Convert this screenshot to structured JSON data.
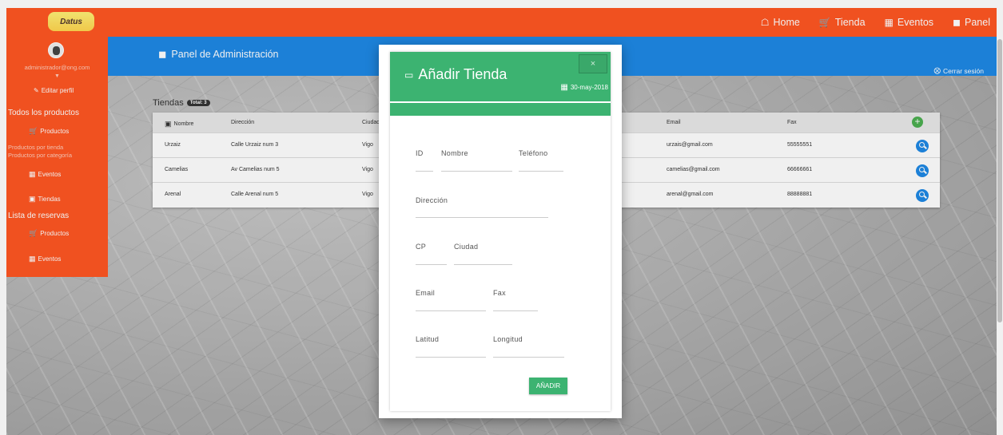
{
  "colors": {
    "orange": "#ff5722",
    "blue": "#1e88e5",
    "green": "#3cb371"
  },
  "navbar": {
    "logo": "Datus",
    "links": [
      {
        "label": "Home",
        "icon": "home-icon"
      },
      {
        "label": "Tienda",
        "icon": "cart-icon"
      },
      {
        "label": "Eventos",
        "icon": "calendar-icon"
      },
      {
        "label": "Panel",
        "icon": "briefcase-icon"
      }
    ]
  },
  "header": {
    "title": "Panel de Administración",
    "logout": "Cerrar sesión"
  },
  "sidebar": {
    "email": "administrador@ong.com",
    "edit_profile": "Editar perfil",
    "all_products": "Todos los productos",
    "products": "Productos",
    "by_store": "Productos por tienda",
    "by_category": "Productos por categoría",
    "events": "Eventos",
    "stores": "Tiendas",
    "reservations": "Lista de reservas",
    "res_products": "Productos",
    "res_events": "Eventos"
  },
  "stores": {
    "title": "Tiendas",
    "badge": "Total: 3",
    "headers": {
      "name": "Nombre",
      "address": "Dirección",
      "city": "Ciudad",
      "email": "Email",
      "fax": "Fax"
    },
    "rows": [
      {
        "name": "Urzaiz",
        "address": "Calle Urzaiz num 3",
        "city": "Vigo",
        "email": "urzais@gmail.com",
        "fax": "55555551"
      },
      {
        "name": "Camelias",
        "address": "Av Camelias num 5",
        "city": "Vigo",
        "email": "camelias@gmail.com",
        "fax": "66666661"
      },
      {
        "name": "Arenal",
        "address": "Calle Arenal num 5",
        "city": "Vigo",
        "email": "arenal@gmail.com",
        "fax": "88888881"
      }
    ]
  },
  "modal": {
    "title": "Añadir Tienda",
    "date": "30-may-2018",
    "close": "×",
    "fields": {
      "id": "ID",
      "name": "Nombre",
      "phone": "Teléfono",
      "address": "Dirección",
      "cp": "CP",
      "city": "Ciudad",
      "email": "Email",
      "fax": "Fax",
      "lat": "Latitud",
      "lng": "Longitud"
    },
    "submit": "AÑADIR"
  }
}
